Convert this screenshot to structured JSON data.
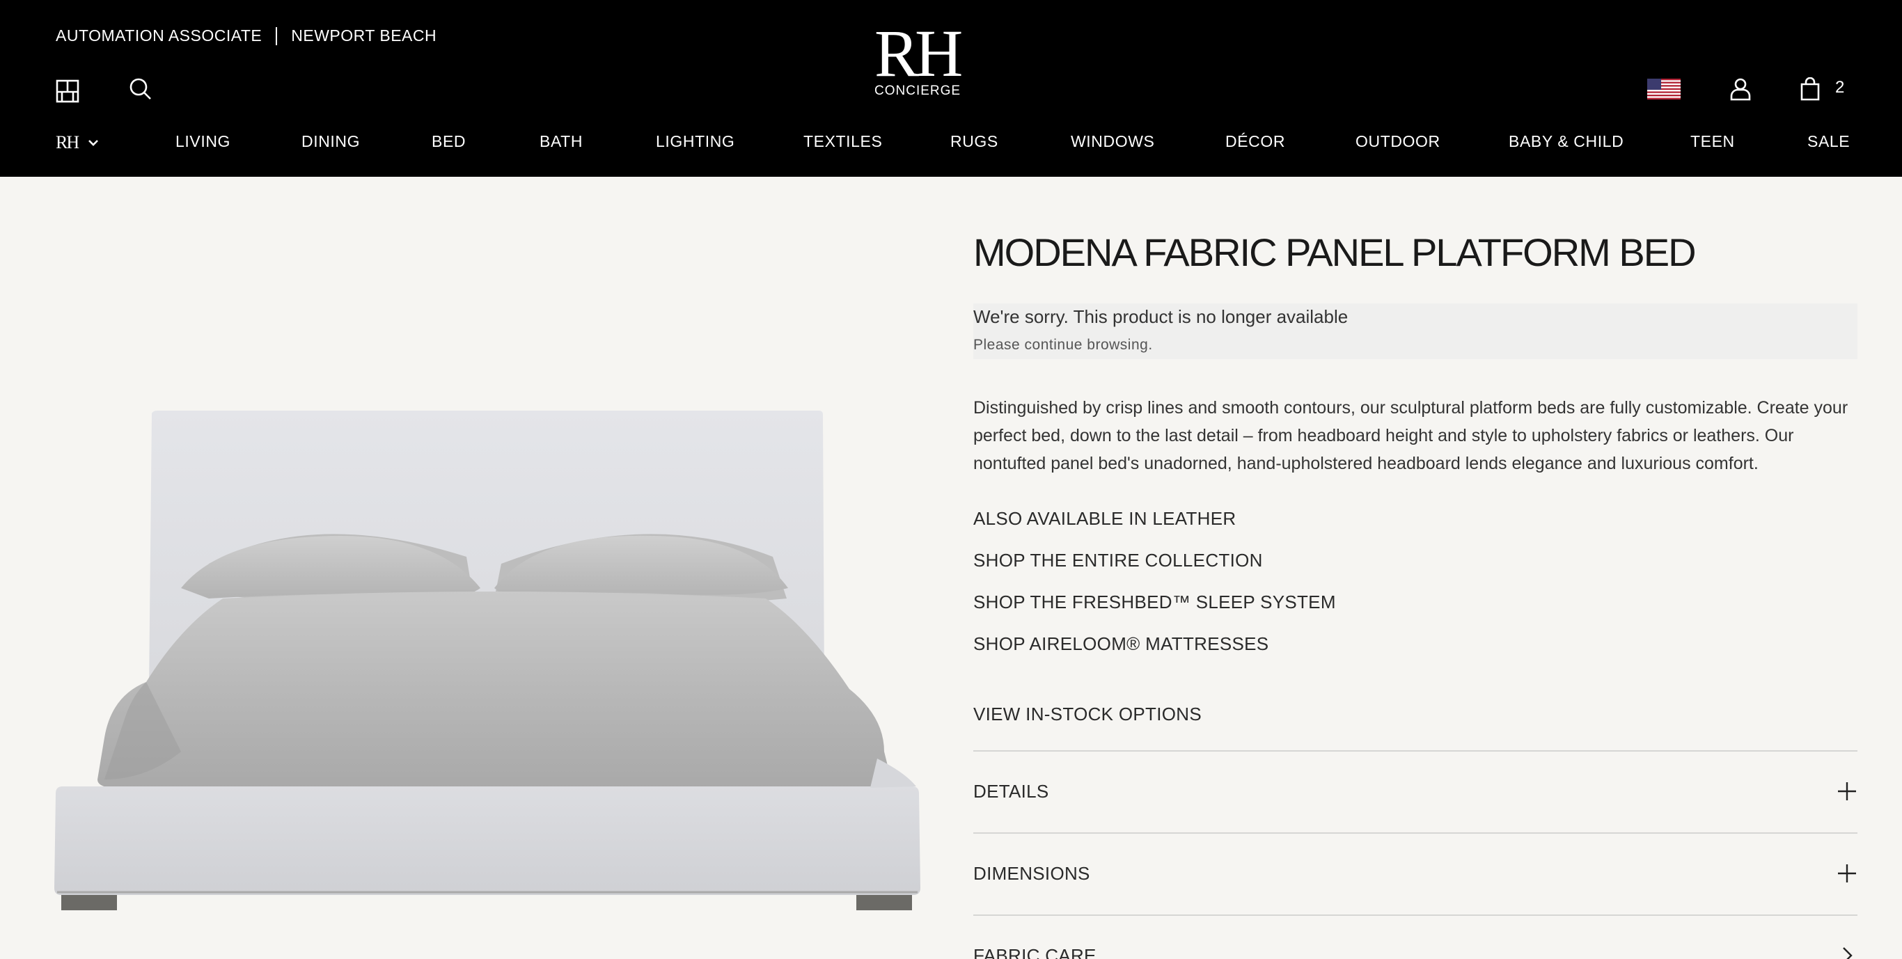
{
  "header": {
    "associate_role": "AUTOMATION ASSOCIATE",
    "store_location": "NEWPORT BEACH",
    "logo_text": "RH",
    "logo_subtext": "CONCIERGE",
    "cart_count": "2",
    "brand_menu_label": "RH",
    "icons": [
      "gallery-icon",
      "search-icon",
      "us-flag-icon",
      "account-icon",
      "shopping-bag-icon",
      "chevron-down-icon"
    ]
  },
  "nav": {
    "items": [
      {
        "label": "LIVING"
      },
      {
        "label": "DINING"
      },
      {
        "label": "BED"
      },
      {
        "label": "BATH"
      },
      {
        "label": "LIGHTING"
      },
      {
        "label": "TEXTILES"
      },
      {
        "label": "RUGS"
      },
      {
        "label": "WINDOWS"
      },
      {
        "label": "DÉCOR"
      },
      {
        "label": "OUTDOOR"
      },
      {
        "label": "BABY & CHILD"
      },
      {
        "label": "TEEN"
      },
      {
        "label": "SALE"
      }
    ]
  },
  "product": {
    "title": "MODENA FABRIC PANEL PLATFORM BED",
    "unavailable_message": "We're sorry. This product is no longer available",
    "unavailable_sub": "Please continue browsing.",
    "description": "Distinguished by crisp lines and smooth contours, our sculptural platform beds are fully customizable. Create your perfect bed, down to the last detail – from headboard height and style to upholstery fabrics or leathers. Our nontufted panel bed's unadorned, hand-upholstered headboard lends elegance and luxurious comfort.",
    "links": [
      {
        "label": "ALSO AVAILABLE IN LEATHER"
      },
      {
        "label": "SHOP THE ENTIRE COLLECTION"
      },
      {
        "label": "SHOP THE FRESHBED™ SLEEP SYSTEM"
      },
      {
        "label": "SHOP AIRELOOM® MATTRESSES"
      }
    ],
    "in_stock_link": "VIEW IN-STOCK OPTIONS",
    "accordions": [
      {
        "label": "DETAILS",
        "icon": "plus-icon"
      },
      {
        "label": "DIMENSIONS",
        "icon": "plus-icon"
      },
      {
        "label": "FABRIC CARE",
        "icon": "chevron-right-icon"
      }
    ]
  },
  "colors": {
    "header_bg": "#000000",
    "page_bg": "#f6f5f2",
    "notice_bg": "#efefee"
  }
}
